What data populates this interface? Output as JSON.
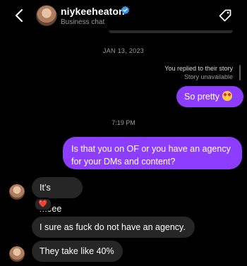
{
  "header": {
    "username": "niykeeheaton",
    "subtitle": "Business chat",
    "verified": true,
    "icons": [
      "back-arrow-icon",
      "verified-badge-icon",
      "tag-icon"
    ]
  },
  "thread": {
    "date_separator": "JAN 13, 2023",
    "story_reply": {
      "line1": "You replied to their story",
      "line2": "Story unavailable"
    },
    "time_separator": "7:19 PM",
    "messages": [
      {
        "from": "me",
        "text": "So pretty",
        "emoji": "heart-eyes-emoji"
      },
      {
        "from": "me",
        "text": "Is that you on OF or you have an agency for your DMs and content?"
      },
      {
        "from": "them",
        "text": "It’s meee",
        "reaction": "❤️"
      },
      {
        "from": "them",
        "text": "I sure as fuck do not have an agency."
      },
      {
        "from": "them",
        "text": "They take like 40%"
      }
    ]
  },
  "colors": {
    "background": "#000000",
    "sent_bubble": "#8d3dff",
    "received_bubble": "#262626",
    "verified_blue": "#3897f0"
  }
}
